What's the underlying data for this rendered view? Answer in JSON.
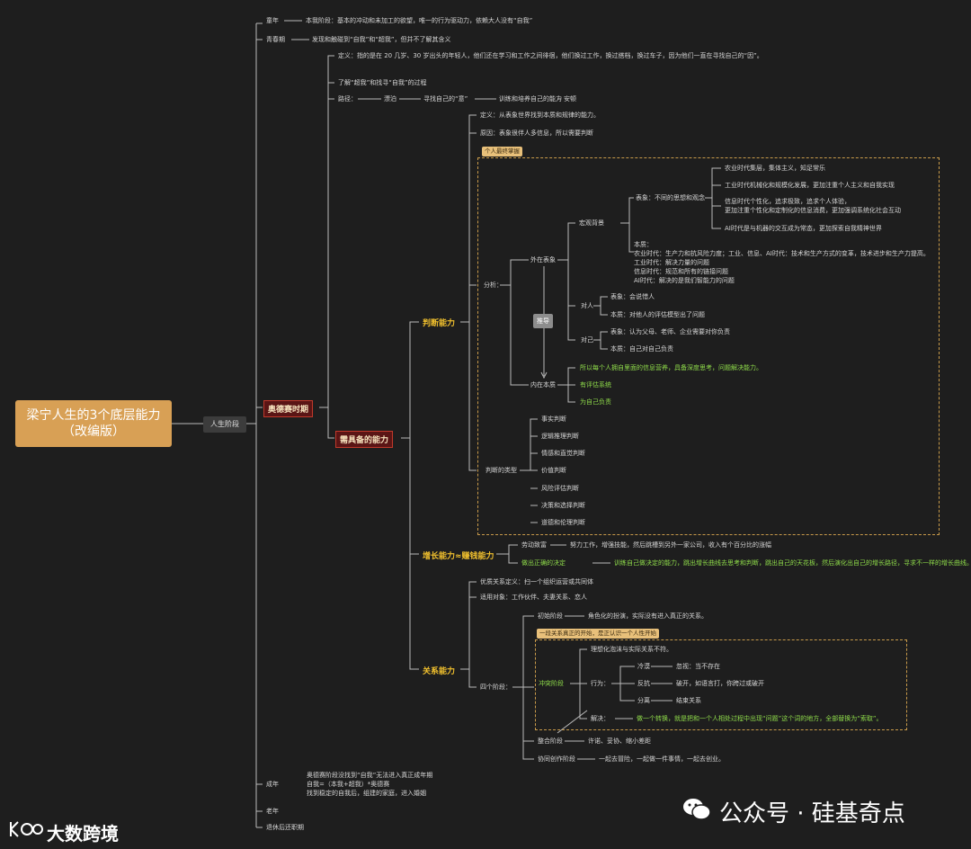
{
  "root": {
    "line1": "梁宁人生的3个底层能力",
    "line2": "（改编版）"
  },
  "life_stage": "人生阶段",
  "stages": {
    "childhood": {
      "label": "童年",
      "text": "本我阶段：基本的冲动和未加工的欲望，唯一的行为驱动力，依赖大人没有“自我”"
    },
    "youth": {
      "label": "青春期",
      "text": "发现和触碰到“自我”和“超我”，但并不了解其含义"
    },
    "odyssey": "奥德赛时期",
    "adult": {
      "label": "成年",
      "lines": [
        "奥德赛阶段没找到“自我”无法进入真正成年期",
        "自我=（本我+超我）*奥德赛",
        "找到稳定的自我后，组建的家庭，进入婚姻"
      ]
    },
    "old": "老年",
    "retired": "退休后还职期"
  },
  "odyssey_items": {
    "definition": "定义：指的是在 20 几岁、30 岁出头的年轻人，他们还在学习和工作之间徘徊，他们换过工作，换过搭档，换过车子，因为他们一直在寻找自己的“因”。",
    "understand": "了解“超我”和找寻“自我”的过程",
    "path": {
      "label": "路径：",
      "steps": [
        "漂泊",
        "寻找自己的“意”",
        "训练和培养自己的能力",
        "安顿"
      ]
    }
  },
  "needed": "需具备的能力",
  "judgment": {
    "title": "判断能力",
    "definition": "定义：从表象世界找到本质和规律的能力。",
    "reason": "原因：表象很伴人多信息，所以需要判断",
    "tag": "个人最终掌握",
    "analysis": "分析：",
    "external": "外在表象",
    "internal": "内在本质",
    "push": "推导",
    "macro": "宏观背景",
    "macro_surface": "表象：不同的思想和观念",
    "macro_items": [
      "农业时代集层，集体主义，知足常乐",
      "工业时代机械化和规模化发展，更加注重个人主义和自我实现",
      "信息时代个性化，追求极致，追求个人体验，",
      "更加注重个性化和定制化的信息消费，更加强调系统化社会互动",
      "AI时代是与机器的交互成为常态，更加探索自我精神世界"
    ],
    "macro_essence": [
      "本质：",
      "农业时代：生产力和抗风险力度；工业、信息、AI时代：技术和生产方式的变革，技术进步和生产力提高。",
      "工业时代：解决力量的问题",
      "信息时代：规范和所有的链接问题",
      "AI时代：解决的是我们智能力的问题"
    ],
    "others": "对人",
    "others_items": [
      "表象：会说惜人",
      "本质：对他人的评估模型出了问题"
    ],
    "self": "对己",
    "self_items": [
      "表象：认为父母、老师、企业需要对你负责",
      "本质：自己对自己负责"
    ],
    "essence_items": [
      "所以每个人拥自里面的信息营养，具备深度思考，问题解决能力。",
      "有评估系统",
      "为自己负责"
    ],
    "types": "判断的类型",
    "type_items": [
      "事实判断",
      "逻辑推理判断",
      "情感和直觉判断",
      "价值判断",
      "风险评估判断",
      "决策和选择判断",
      "道德和伦理判断"
    ]
  },
  "growth": {
    "title": "增长能力≈赚钱能力",
    "a_label": "劳动致富",
    "a_text": "努力工作，增强技能，然后跳槽到另外一家公司，收入有个百分比的涨幅",
    "b_label": "做出正确的决定",
    "b_text": "训练自己做决定的能力，跳出增长曲线去思考和判断，跳出自己的天花板，然后演化出自己的增长路径，寻求不一样的增长曲线。"
  },
  "relation": {
    "title": "关系能力",
    "definition": "优质关系定义：扫一个组织运营或共同体",
    "objects": "适用对象：工作伙伴、夫妻关系、恋人",
    "stages_label": "四个阶段：",
    "s1_label": "初始阶段",
    "s1_text": "角色化的扮演，实际没有进入真正的关系。",
    "tag": "一段关系真正的开始，是正认识一个人性开始",
    "conflict": "冲突阶段",
    "conflict_desc": "理想化泡沫与实际关系不符。",
    "behavior": "行为：",
    "behaviors": [
      {
        "k": "冷漠",
        "v": "忽视：当不存在"
      },
      {
        "k": "反抗",
        "v": "破开，如语言打，你跨过或破开"
      },
      {
        "k": "分离",
        "v": "结束关系"
      }
    ],
    "solve": "解决：",
    "solve_text": "做一个转换，就是把和一个人相处过程中出现“问题”这个词的地方，全部替换为“索取”。",
    "s3_label": "整合阶段",
    "s3_text": "许诺、妥协、缩小差距",
    "s4_label": "协同创作阶段",
    "s4_text": "一起去冒险，一起做一件事情，一起去创业。"
  },
  "watermark": {
    "left": "大数跨境",
    "right": "公众号 · 硅基奇点"
  }
}
